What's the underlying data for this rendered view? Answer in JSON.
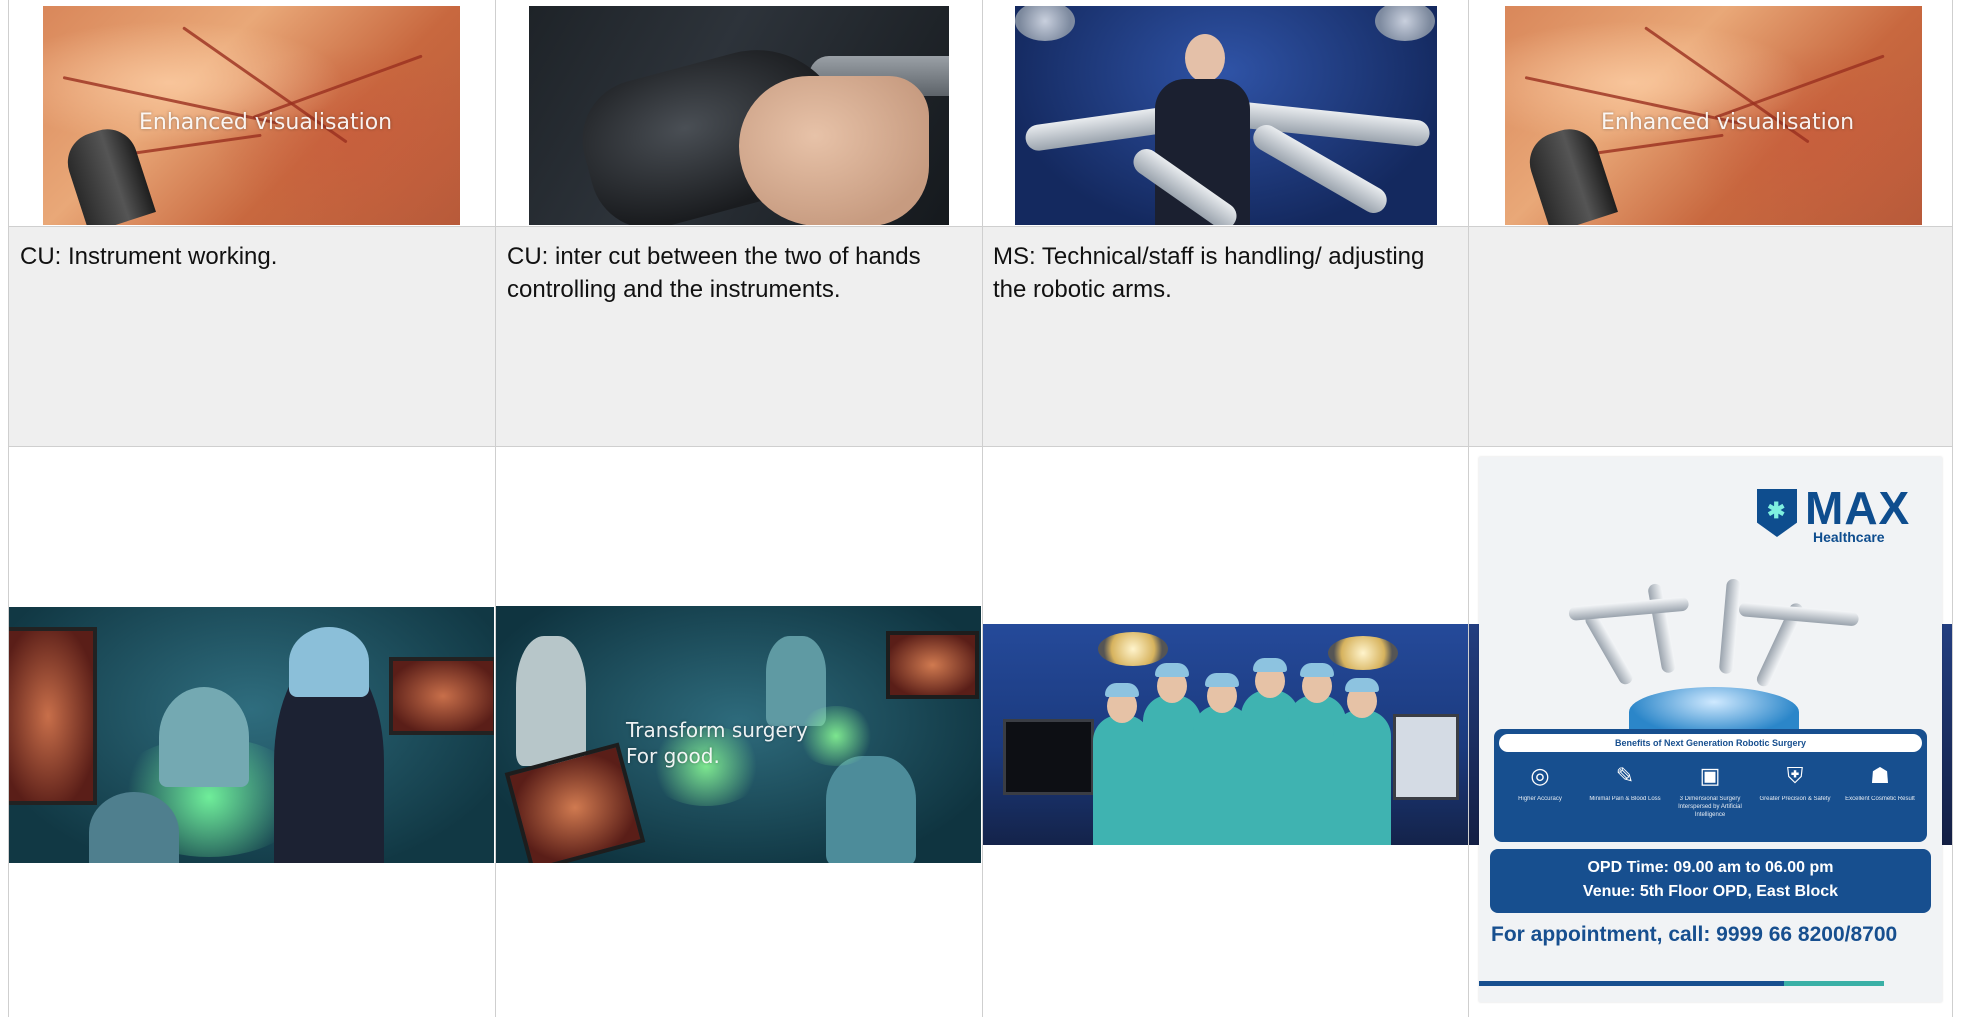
{
  "storyboard": {
    "top_row": [
      {
        "overlay": "Enhanced visualisation"
      },
      {
        "overlay": ""
      },
      {
        "overlay": ""
      },
      {
        "overlay": "Enhanced visualisation"
      }
    ],
    "captions": [
      "CU: Instrument working.",
      "CU: inter cut between the two of hands controlling and the instruments.",
      "MS: Technical/staff  is handling/ adjusting the robotic arms.",
      ""
    ],
    "bottom_row": [
      {
        "overlay_line1": "",
        "overlay_line2": ""
      },
      {
        "overlay_line1": "Transform surgery",
        "overlay_line2": "For good."
      },
      {
        "overlay_line1": "",
        "overlay_line2": ""
      }
    ]
  },
  "poster": {
    "brand": "MAX",
    "brand_sub": "Healthcare",
    "benefits_title": "Benefits of Next Generation Robotic Surgery",
    "benefits": [
      {
        "icon": "target-icon",
        "glyph": "◎",
        "label": "Higher Accuracy"
      },
      {
        "icon": "pen-icon",
        "glyph": "✎",
        "label": "Minimal Pain & Blood Loss"
      },
      {
        "icon": "computer-icon",
        "glyph": "▣",
        "label": "3 Dimensional Surgery Interspersed by Artificial Intelligence"
      },
      {
        "icon": "shield-icon",
        "glyph": "⛨",
        "label": "Greater Precision & Safety"
      },
      {
        "icon": "doctor-icon",
        "glyph": "☗",
        "label": "Excellent Cosmetic Result"
      }
    ],
    "opd_time": "OPD Time: 09.00 am to 06.00 pm",
    "venue": "Venue: 5th Floor OPD, East Block",
    "appointment": "For appointment, call: 9999 66 8200/8700",
    "colors": {
      "brand_blue": "#174f8f",
      "accent_teal": "#3ab0a6"
    }
  }
}
